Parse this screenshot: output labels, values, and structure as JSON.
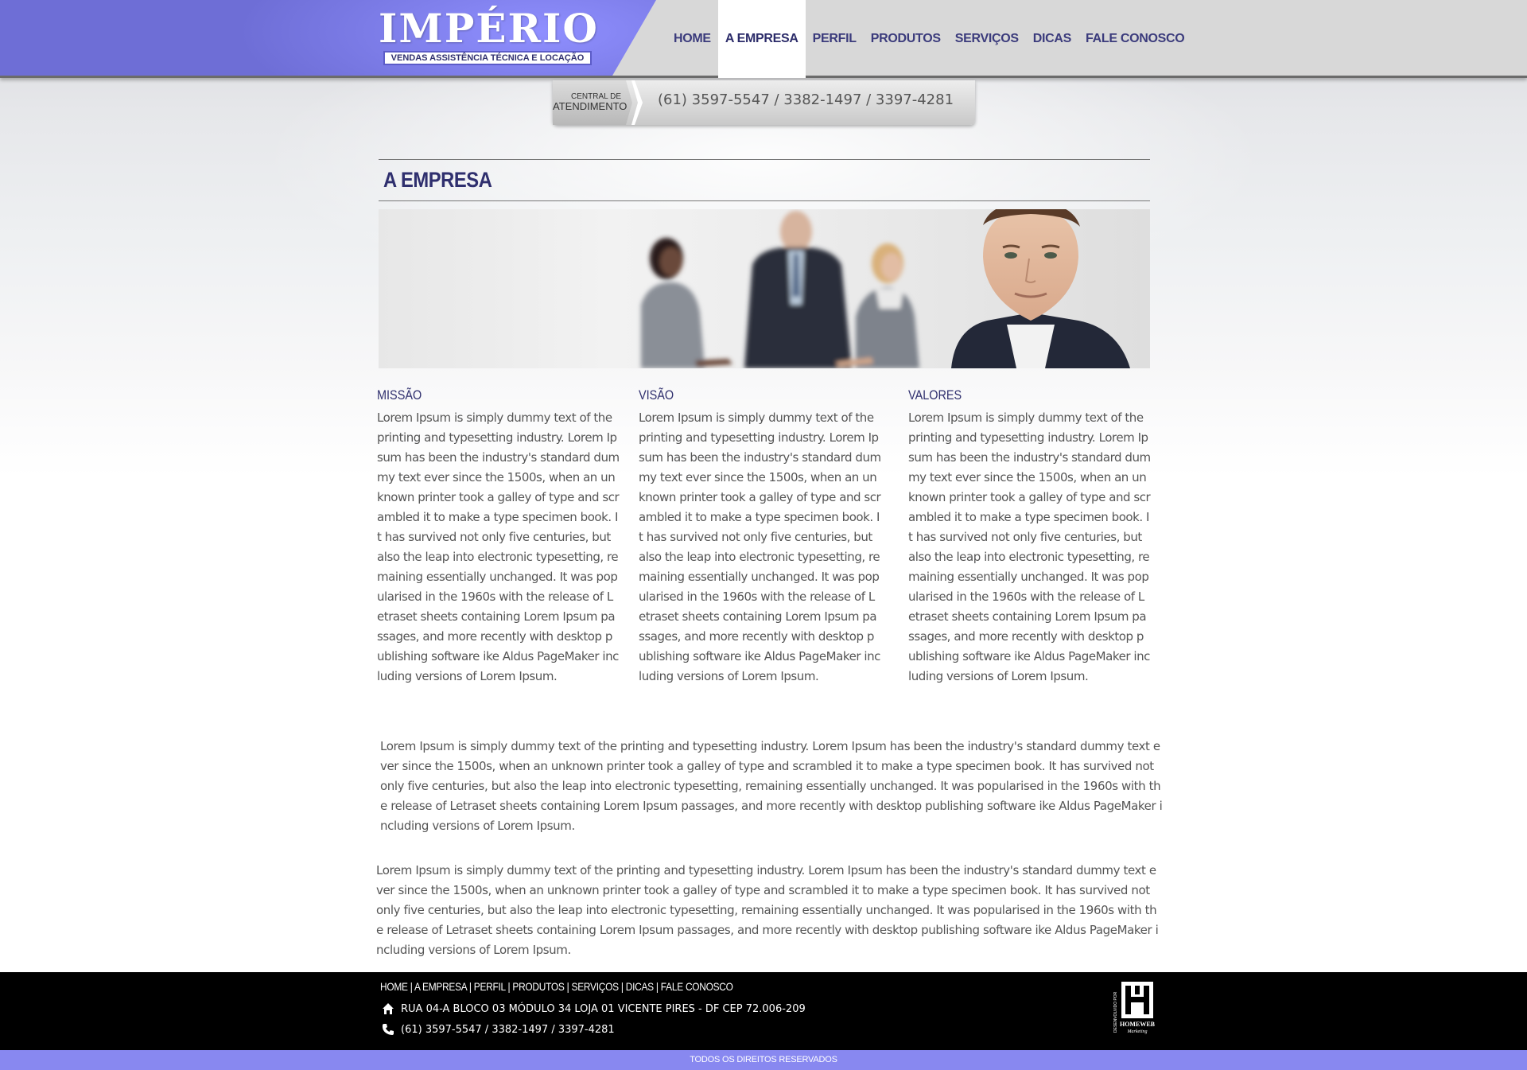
{
  "brand": {
    "name": "IMPÉRIO",
    "tagline": "VENDAS ASSISTÊNCIA TÉCNICA E LOCAÇÃO",
    "accent_color": "#8888f0",
    "title_color": "#2f2f6e"
  },
  "nav": {
    "items": [
      {
        "label": "HOME"
      },
      {
        "label": "A EMPRESA",
        "active": true
      },
      {
        "label": "PERFIL"
      },
      {
        "label": "PRODUTOS"
      },
      {
        "label": "SERVIÇOS"
      },
      {
        "label": "DICAS"
      },
      {
        "label": "FALE CONOSCO"
      }
    ]
  },
  "contact_bar": {
    "label_line1": "CENTRAL DE",
    "label_line2": "ATENDIMENTO",
    "phones": "(61) 3597-5547 / 3382-1497 / 3397-4281"
  },
  "page": {
    "title": "A EMPRESA",
    "banner_icon": "business-people-photo"
  },
  "columns": [
    {
      "heading": "MISSÃO",
      "text": "Lorem Ipsum is simply dummy text of the printing and typesetting industry. Lorem Ipsum has been the industry's standard dummy text ever since the 1500s, when an unknown printer took a galley of type and scrambled it to make a type specimen book. It has survived not only five centuries, but also the leap into electronic typesetting, remaining essentially unchanged. It was popularised in the 1960s with the release of Letraset sheets containing Lorem Ipsum passages, and more recently with desktop publishing software ike Aldus PageMaker including versions of Lorem Ipsum."
    },
    {
      "heading": "VISÃO",
      "text": "Lorem Ipsum is simply dummy text of the printing and typesetting industry. Lorem Ipsum has been the industry's standard dummy text ever since the 1500s, when an unknown printer took a galley of type and scrambled it to make a type specimen book. It has survived not only five centuries, but also the leap into electronic typesetting, remaining essentially unchanged. It was popularised in the 1960s with the release of Letraset sheets containing Lorem Ipsum passages, and more recently with desktop publishing software ike Aldus PageMaker including versions of Lorem Ipsum."
    },
    {
      "heading": "VALORES",
      "text": "Lorem Ipsum is simply dummy text of the printing and typesetting industry. Lorem Ipsum has been the industry's standard dummy text ever since the 1500s, when an unknown printer took a galley of type and scrambled it to make a type specimen book. It has survived not only five centuries, but also the leap into electronic typesetting, remaining essentially unchanged. It was popularised in the 1960s with the release of Letraset sheets containing Lorem Ipsum passages, and more recently with desktop publishing software ike Aldus PageMaker including versions of Lorem Ipsum."
    }
  ],
  "paragraphs": [
    "Lorem Ipsum is simply dummy text of the printing and typesetting industry. Lorem Ipsum has been the industry's standard dummy text ever since the 1500s, when an unknown printer took a galley of type and scrambled it to make a type specimen book. It has survived not only five centuries, but also the leap into electronic typesetting, remaining essentially unchanged. It was popularised in the 1960s with the release of Letraset sheets containing Lorem Ipsum passages, and more recently with desktop publishing software ike Aldus PageMaker including versions of Lorem Ipsum.",
    "Lorem Ipsum is simply dummy text of the printing and typesetting industry. Lorem Ipsum has been the industry's standard dummy text ever since the 1500s, when an unknown printer took a galley of type and scrambled it to make a type specimen book. It has survived not only five centuries, but also the leap into electronic typesetting, remaining essentially unchanged. It was popularised in the 1960s with the release of Letraset sheets containing Lorem Ipsum passages, and more recently with desktop publishing software ike Aldus PageMaker including versions of Lorem Ipsum."
  ],
  "footer": {
    "nav": [
      "HOME",
      "A EMPRESA",
      "PERFIL",
      "PRODUTOS",
      "SERVIÇOS",
      "DICAS",
      "FALE CONOSCO"
    ],
    "nav_separator": " | ",
    "address_icon": "home-icon",
    "address": "RUA 04-A BLOCO 03 MÓDULO 34 LOJA 01 VICENTE PIRES - DF CEP 72.006-209",
    "phone_icon": "phone-icon",
    "phones": "(61) 3597-5547 / 3382-1497 / 3397-4281",
    "developer_logo": {
      "icon": "homeweb-logo",
      "side_text": "DESENVOLVIDO POR",
      "name": "HOMEWEB",
      "sub": "Marketing"
    },
    "copyright": "TODOS OS DIREITOS RESERVADOS"
  }
}
